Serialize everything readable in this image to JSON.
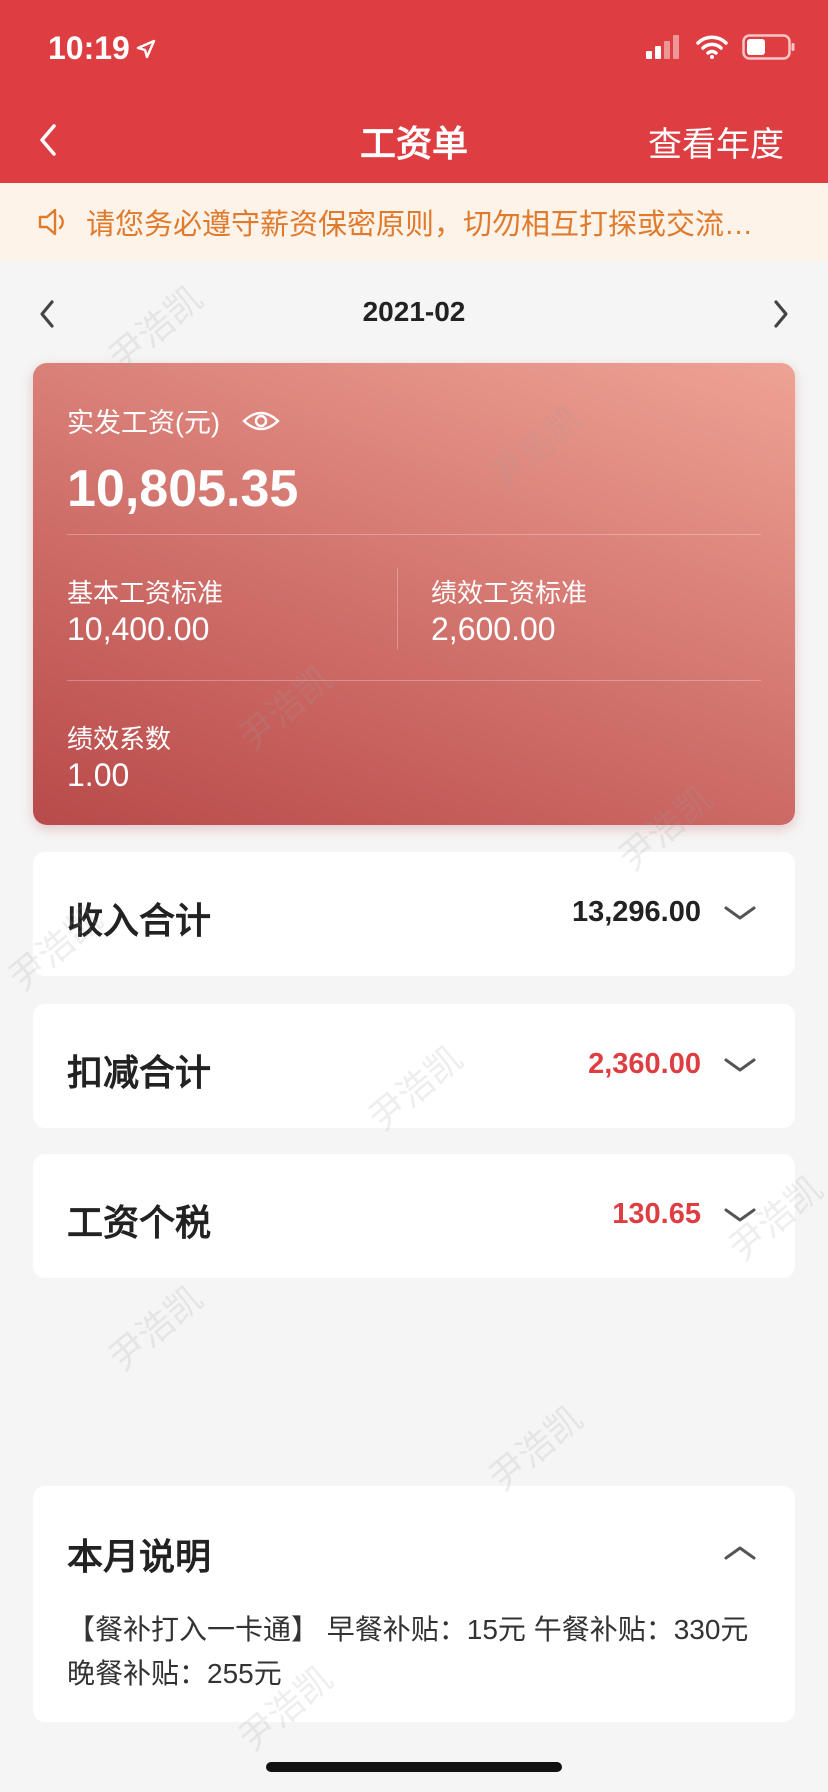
{
  "status": {
    "time": "10:19"
  },
  "nav": {
    "title": "工资单",
    "right_label": "查看年度"
  },
  "notice": {
    "text": "请您务必遵守薪资保密原则，切勿相互打探或交流…"
  },
  "month": {
    "label": "2021-02"
  },
  "salary": {
    "net_label": "实发工资(元)",
    "net_value": "10,805.35",
    "base_label": "基本工资标准",
    "base_value": "10,400.00",
    "perf_label": "绩效工资标准",
    "perf_value": "2,600.00",
    "coef_label": "绩效系数",
    "coef_value": "1.00"
  },
  "sections": [
    {
      "title": "收入合计",
      "value": "13,296.00",
      "color": "#222222"
    },
    {
      "title": "扣减合计",
      "value": "2,360.00",
      "color": "#de3e42"
    },
    {
      "title": "工资个税",
      "value": "130.65",
      "color": "#de3e42"
    }
  ],
  "note": {
    "title": "本月说明",
    "text": "【餐补打入一卡通】 早餐补贴：15元 午餐补贴：330元 晚餐补贴：255元"
  },
  "watermark": "尹浩凯",
  "colors": {
    "brand": "#de3e42",
    "notice": "#e07a2c"
  }
}
